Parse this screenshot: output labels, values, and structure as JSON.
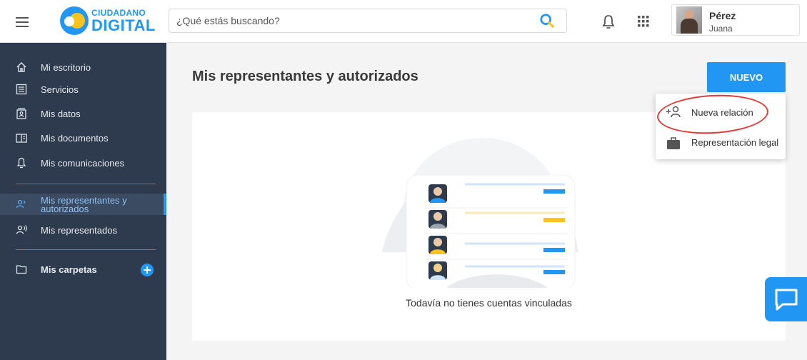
{
  "header": {
    "logo_top": "CIUDADANO",
    "logo_bottom": "DIGITAL",
    "search_placeholder": "¿Qué estás buscando?",
    "user_last_name": "Pérez",
    "user_first_name": "Juana"
  },
  "sidebar": {
    "items": [
      {
        "label": "Mi escritorio",
        "icon": "home-icon"
      },
      {
        "label": "Servicios",
        "icon": "list-icon"
      },
      {
        "label": "Mis datos",
        "icon": "id-card-icon"
      },
      {
        "label": "Mis documentos",
        "icon": "documents-icon"
      },
      {
        "label": "Mis comunicaciones",
        "icon": "bell-icon"
      },
      {
        "label_line1": "Mis representantes y",
        "label_line2": "autorizados",
        "icon": "people-icon",
        "active": true
      },
      {
        "label": "Mis representados",
        "icon": "person-voice-icon"
      },
      {
        "label": "Mis carpetas",
        "icon": "folder-icon"
      }
    ]
  },
  "main": {
    "title": "Mis representantes y autorizados",
    "new_button": "NUEVO",
    "empty_message": "Todavía no tienes cuentas vinculadas"
  },
  "menu": {
    "items": [
      {
        "label": "Nueva relación",
        "icon": "add-person-icon"
      },
      {
        "label": "Representación legal",
        "icon": "briefcase-icon"
      }
    ]
  },
  "colors": {
    "primary": "#2196f3",
    "sidebar": "#2e3b4e",
    "highlight": "#e53935",
    "accent_yellow": "#ffc31f"
  }
}
